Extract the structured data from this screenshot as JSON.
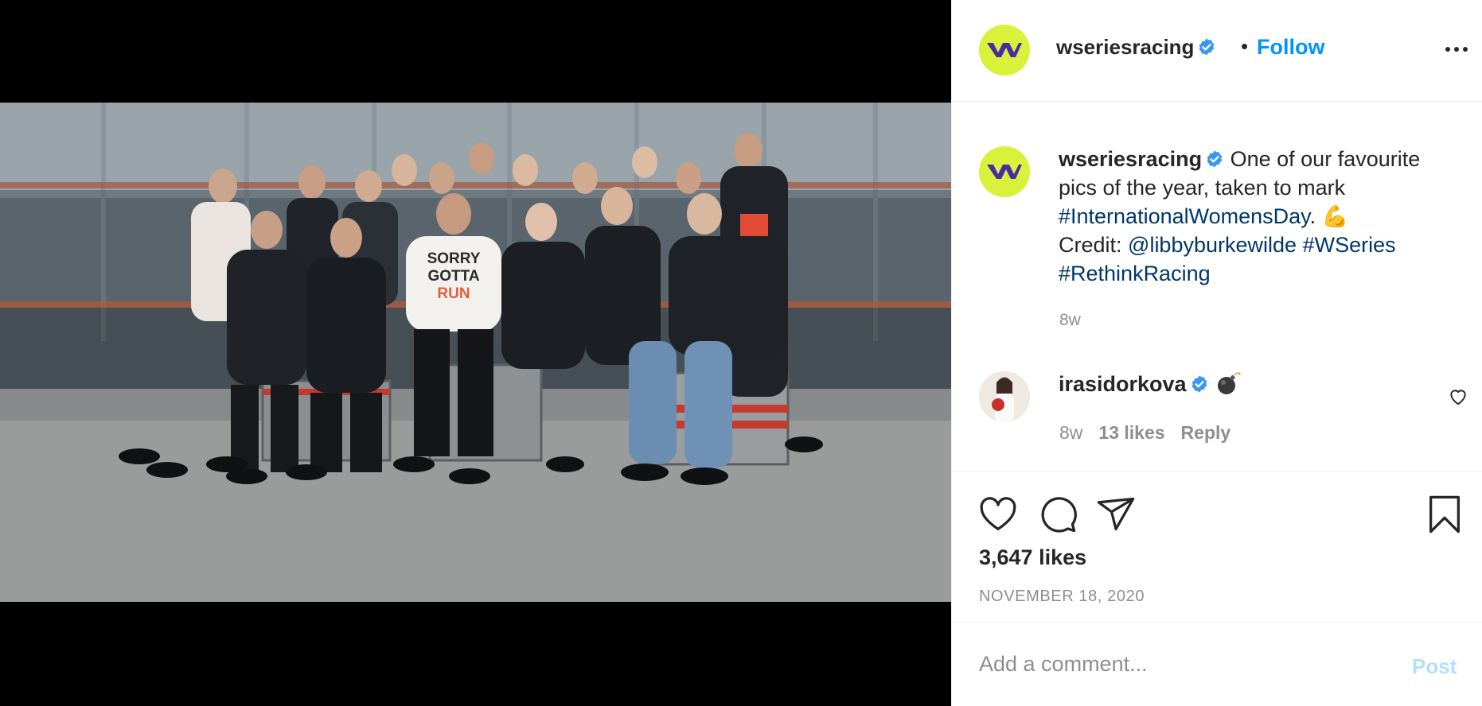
{
  "post_image": {
    "alt": "Group photo of W Series drivers",
    "shirt_text": [
      "SORRY",
      "GOTTA",
      "RUN"
    ]
  },
  "header": {
    "username": "wseriesracing",
    "separator": "•",
    "follow_label": "Follow",
    "more_icon": "more-horizontal-icon"
  },
  "caption": {
    "username": "wseriesracing",
    "text_1": " One of our favourite pics of the year, taken to mark ",
    "hashtag_1": "#InternationalWomensDay",
    "text_2": ". ",
    "emoji": "💪",
    "credit_label": "Credit: ",
    "mention": "@libbyburkewilde",
    "hashtag_2": "#WSeries",
    "hashtag_3": "#RethinkRacing",
    "time": "8w"
  },
  "comment": {
    "username": "irasidorkova",
    "emoji": "bomb",
    "time": "8w",
    "likes": "13 likes",
    "reply_label": "Reply"
  },
  "actions": {
    "likes": "3,647 likes",
    "date": "NOVEMBER 18, 2020"
  },
  "add_comment": {
    "placeholder": "Add a comment...",
    "post_label": "Post"
  },
  "colors": {
    "accent": "#0095f6",
    "brand": "#d8f23c",
    "link": "#00376b"
  }
}
